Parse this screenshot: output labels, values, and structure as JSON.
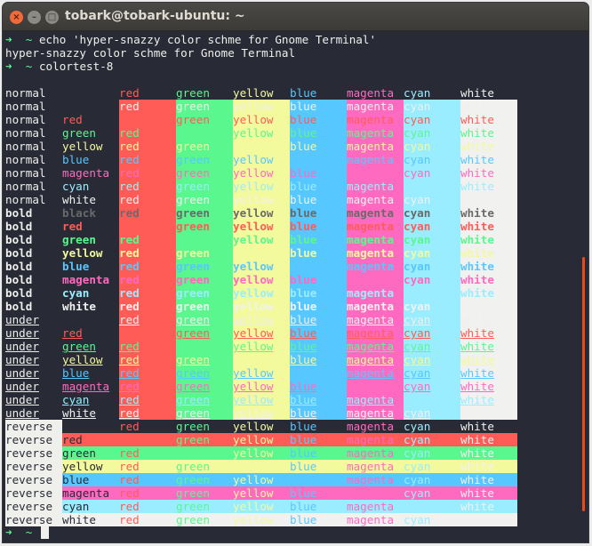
{
  "window": {
    "title": "tobark@tobark-ubuntu: ~",
    "close_glyph": "×",
    "min_glyph": "–",
    "max_glyph": "□"
  },
  "terminal": {
    "prompt_arrow": "➜",
    "prompt_dir": "~",
    "line1_cmd": "echo 'hyper-snazzy color schme for Gnome Terminal'",
    "line2_output": "hyper-snazzy color schme for Gnome Terminal",
    "line3_cmd": "colortest-8"
  },
  "colors": {
    "background": "#282a36",
    "foreground": "#eff0eb",
    "palette": {
      "black": "#282a36",
      "red": "#ff5c57",
      "green": "#5af78e",
      "yellow": "#f3f99d",
      "blue": "#57c7ff",
      "magenta": "#ff6ac1",
      "cyan": "#9aedfe",
      "white": "#f1f1f0"
    }
  },
  "colortest": {
    "header_bg_labels": [
      "red",
      "green",
      "yellow",
      "blue",
      "magenta",
      "cyan",
      "white"
    ],
    "styles": [
      "normal",
      "bold",
      "under",
      "reverse"
    ],
    "fg_names": [
      "",
      "red",
      "green",
      "yellow",
      "blue",
      "magenta",
      "cyan",
      "white"
    ],
    "bold_first_fg": "black"
  }
}
